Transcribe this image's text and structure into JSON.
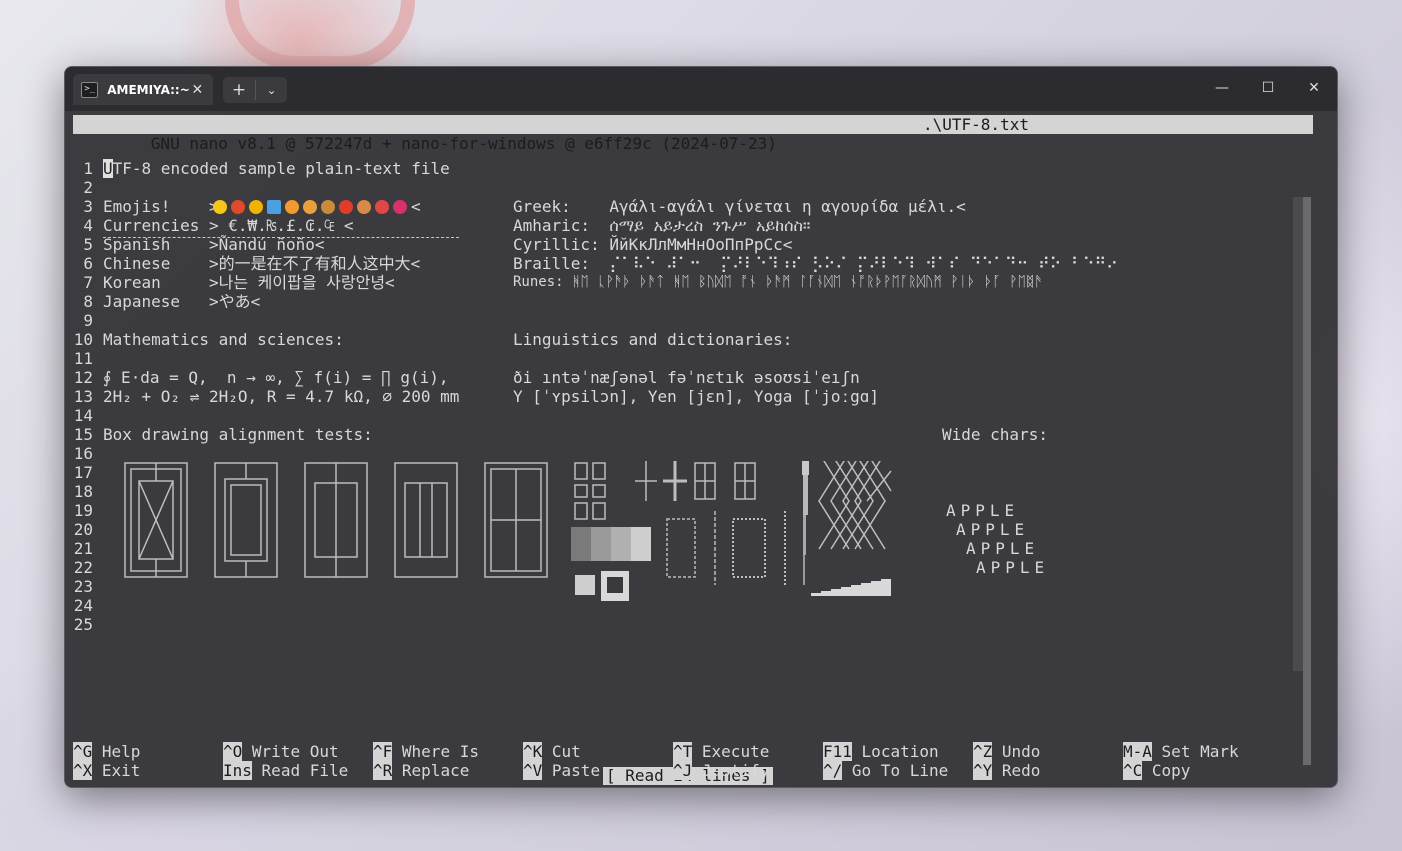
{
  "tab": {
    "title": "AMEMIYA::~",
    "icon": "terminal-icon"
  },
  "window_controls": {
    "minimize": "—",
    "maximize": "☐",
    "close": "✕"
  },
  "nano": {
    "header": "GNU nano v8.1 @ 572247d + nano-for-windows @ e6ff29c (2024-07-23)",
    "filename": ".\\UTF-8.txt",
    "status": "[ Read 24 lines ]"
  },
  "line_numbers": [
    "1",
    "2",
    "3",
    "4",
    "5",
    "6",
    "7",
    "8",
    "9",
    "10",
    "11",
    "12",
    "13",
    "14",
    "15",
    "16",
    "17",
    "18",
    "19",
    "20",
    "21",
    "22",
    "23",
    "24",
    "25"
  ],
  "content": {
    "l1_cursor": "U",
    "l1_rest": "TF-8 encoded sample plain-text file",
    "l3_label": "Emojis!    >",
    "l3_end": "<",
    "l4": "Currencies > €.₩.₨.£.₢.₠ <",
    "l5": "Spanish    >Ñandú ñoño<",
    "l6": "Chinese    >的一是在不了有和人这中大<",
    "l7": "Korean     >나는 케이팝을 사랑안녕<",
    "l8": "Japanese   >やあ<",
    "l10_left": "Mathematics and sciences:",
    "l10_right": "Linguistics and dictionaries:",
    "l12_left": "∮ E⋅da = Q,  n → ∞, ∑ f(i) = ∏ g(i),",
    "l12_right": "ði ıntəˈnæʃənəl fəˈnɛtık əsoʊsiˈeıʃn",
    "l13_left": "2H₂ + O₂ ⇌ 2H₂O, R = 4.7 kΩ, ⌀ 200 mm",
    "l13_right": "Y [ˈʏpsilɔn], Yen [jɛn], Yoga [ˈjoːgɑ]",
    "l15_left": "Box drawing alignment tests:",
    "l15_right": "Wide chars:",
    "greek": "Greek:    Αγάλι-αγάλι γίνεται η αγουρίδα μέλι.<",
    "amharic": "Amharic:  ሰማይ አይታረስ ንጉሥ አይከሰስ።",
    "cyrillic": "Cyrillic: ЙйКкЛлМмНнОоПпРрСс<",
    "braille": "Braille:  ⡌⠁⠧⠑ ⠼⠁⠒  ⡍⠜⠇⠑⠹⠰⠎ ⡣⠕⠌ ⡍⠜⠇⠑⠹ ⠺⠁⠎ ⠙⠑⠁⠙⠒ ⠞⠕ ⠃⠑⠛⠔",
    "runes": "Runes: ᚻᛖ ᚳᚹᚫᚦ ᚦᚫᛏ ᚻᛖ ᛒᚢᛞᛖ ᚩᚾ ᚦᚫᛗ ᛚᚪᚾᛞᛖ ᚾᚩᚱᚦᚹᛖᚪᚱᛞᚢᛗ ᚹᛁᚦ ᚦᚪ ᚹᛖᛥᚫ"
  },
  "wide_chars": [
    "APPLE",
    "APPLE",
    "APPLE",
    "APPLE"
  ],
  "shortcuts": [
    {
      "key": "^G",
      "label": "Help"
    },
    {
      "key": "^O",
      "label": "Write Out"
    },
    {
      "key": "^F",
      "label": "Where Is"
    },
    {
      "key": "^K",
      "label": "Cut"
    },
    {
      "key": "^T",
      "label": "Execute"
    },
    {
      "key": "F11",
      "label": "Location"
    },
    {
      "key": "^Z",
      "label": "Undo"
    },
    {
      "key": "M-A",
      "label": "Set Mark"
    },
    {
      "key": "^X",
      "label": "Exit"
    },
    {
      "key": "Ins",
      "label": "Read File"
    },
    {
      "key": "^R",
      "label": "Replace"
    },
    {
      "key": "^V",
      "label": "Paste"
    },
    {
      "key": "^J",
      "label": "Justify"
    },
    {
      "key": "^/",
      "label": "Go To Line"
    },
    {
      "key": "^Y",
      "label": "Redo"
    },
    {
      "key": "^C",
      "label": "Copy"
    }
  ],
  "emoji_colors": [
    "#f5c518",
    "#e04a2a",
    "#f0b400",
    "#4aa0e0",
    "#f29a30",
    "#e8a13a",
    "#c98a3a",
    "#e03c2a",
    "#d88a48",
    "#e04848",
    "#d8306a"
  ]
}
